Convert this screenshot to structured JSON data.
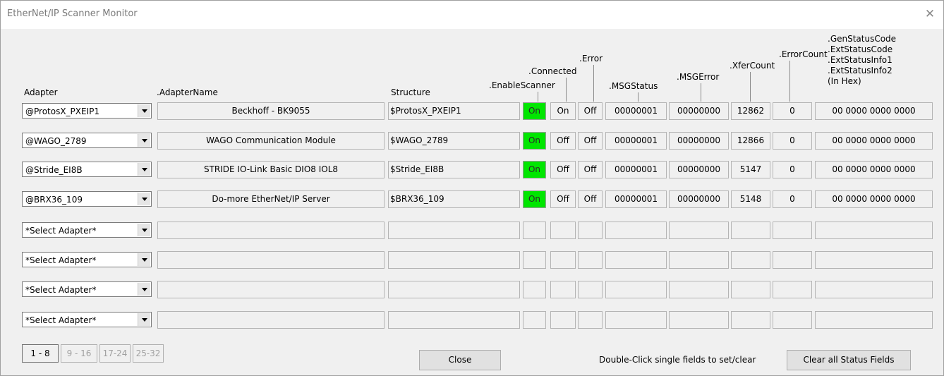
{
  "window": {
    "title": "EtherNet/IP Scanner Monitor",
    "close_glyph": "✕"
  },
  "headers": {
    "adapter": "Adapter",
    "adapter_name": ".AdapterName",
    "structure": "Structure",
    "enable_scanner": ".EnableScanner",
    "connected": ".Connected",
    "error": ".Error",
    "msg_status": ".MSGStatus",
    "msg_error": ".MSGError",
    "xfer_count": ".XferCount",
    "error_count": ".ErrorCount",
    "gen_status": [
      ".GenStatusCode",
      ".ExtStatusCode",
      ".ExtStatusInfo1",
      ".ExtStatusInfo2",
      "(In Hex)"
    ]
  },
  "rows": [
    {
      "adapter": "@ProtosX_PXEIP1",
      "adapter_name": "Beckhoff - BK9055",
      "structure": "$ProtosX_PXEIP1",
      "enable": "On",
      "connected": "On",
      "error": "Off",
      "msg_status": "00000001",
      "msg_error": "00000000",
      "xfer_count": "12862",
      "error_count": "0",
      "gen_status": "00 0000 0000 0000"
    },
    {
      "adapter": "@WAGO_2789",
      "adapter_name": "WAGO Communication Module",
      "structure": "$WAGO_2789",
      "enable": "On",
      "connected": "Off",
      "error": "Off",
      "msg_status": "00000001",
      "msg_error": "00000000",
      "xfer_count": "12866",
      "error_count": "0",
      "gen_status": "00 0000 0000 0000"
    },
    {
      "adapter": "@Stride_EI8B",
      "adapter_name": "STRIDE IO-Link Basic DIO8 IOL8",
      "structure": "$Stride_EI8B",
      "enable": "On",
      "connected": "Off",
      "error": "Off",
      "msg_status": "00000001",
      "msg_error": "00000000",
      "xfer_count": "5147",
      "error_count": "0",
      "gen_status": "00 0000 0000 0000"
    },
    {
      "adapter": "@BRX36_109",
      "adapter_name": "Do-more EtherNet/IP Server",
      "structure": "$BRX36_109",
      "enable": "On",
      "connected": "Off",
      "error": "Off",
      "msg_status": "00000001",
      "msg_error": "00000000",
      "xfer_count": "5148",
      "error_count": "0",
      "gen_status": "00 0000 0000 0000"
    },
    {
      "adapter": "*Select Adapter*",
      "adapter_name": "",
      "structure": "",
      "enable": "",
      "connected": "",
      "error": "",
      "msg_status": "",
      "msg_error": "",
      "xfer_count": "",
      "error_count": "",
      "gen_status": ""
    },
    {
      "adapter": "*Select Adapter*",
      "adapter_name": "",
      "structure": "",
      "enable": "",
      "connected": "",
      "error": "",
      "msg_status": "",
      "msg_error": "",
      "xfer_count": "",
      "error_count": "",
      "gen_status": ""
    },
    {
      "adapter": "*Select Adapter*",
      "adapter_name": "",
      "structure": "",
      "enable": "",
      "connected": "",
      "error": "",
      "msg_status": "",
      "msg_error": "",
      "xfer_count": "",
      "error_count": "",
      "gen_status": ""
    },
    {
      "adapter": "*Select Adapter*",
      "adapter_name": "",
      "structure": "",
      "enable": "",
      "connected": "",
      "error": "",
      "msg_status": "",
      "msg_error": "",
      "xfer_count": "",
      "error_count": "",
      "gen_status": ""
    }
  ],
  "pages": [
    "1 - 8",
    "9 - 16",
    "17-24",
    "25-32"
  ],
  "footer": {
    "close_label": "Close",
    "hint": "Double-Click single fields to set/clear",
    "clear_label": "Clear all Status Fields"
  },
  "colors": {
    "enabled_on": "#00e600"
  }
}
